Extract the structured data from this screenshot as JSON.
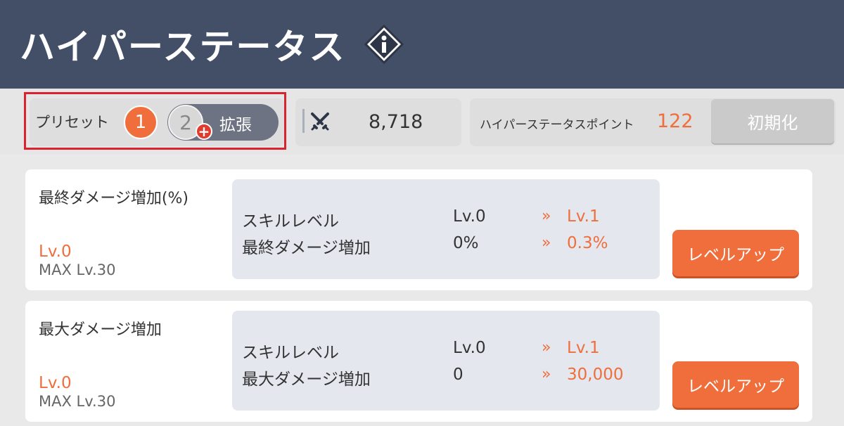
{
  "header": {
    "title": "ハイパーステータス",
    "info_icon": "info-diamond-icon"
  },
  "preset": {
    "label": "プリセット",
    "slot1": "1",
    "slot2": "2",
    "plus": "+",
    "expand_label": "拡張",
    "highlight_color": "#d9232e"
  },
  "power": {
    "icon": "crossed-swords-icon",
    "value": "8,718"
  },
  "points": {
    "label": "ハイパーステータスポイント",
    "value": "122",
    "reset_label": "初期化"
  },
  "stats": [
    {
      "name": "最終ダメージ増加(%)",
      "level": "Lv.0",
      "max": "MAX Lv.30",
      "rows": [
        {
          "label": "スキルレベル",
          "current": "Lv.0",
          "arrow": "»",
          "next": "Lv.1"
        },
        {
          "label": "最終ダメージ増加",
          "current": "0%",
          "arrow": "»",
          "next": "0.3%"
        }
      ],
      "button": "レベルアップ"
    },
    {
      "name": "最大ダメージ増加",
      "level": "Lv.0",
      "max": "MAX Lv.30",
      "rows": [
        {
          "label": "スキルレベル",
          "current": "Lv.0",
          "arrow": "»",
          "next": "Lv.1"
        },
        {
          "label": "最大ダメージ増加",
          "current": "0",
          "arrow": "»",
          "next": "30,000"
        }
      ],
      "button": "レベルアップ"
    }
  ],
  "colors": {
    "header_bg": "#424f66",
    "accent": "#ef6e3c",
    "panel_bg": "#e4e7ee"
  }
}
